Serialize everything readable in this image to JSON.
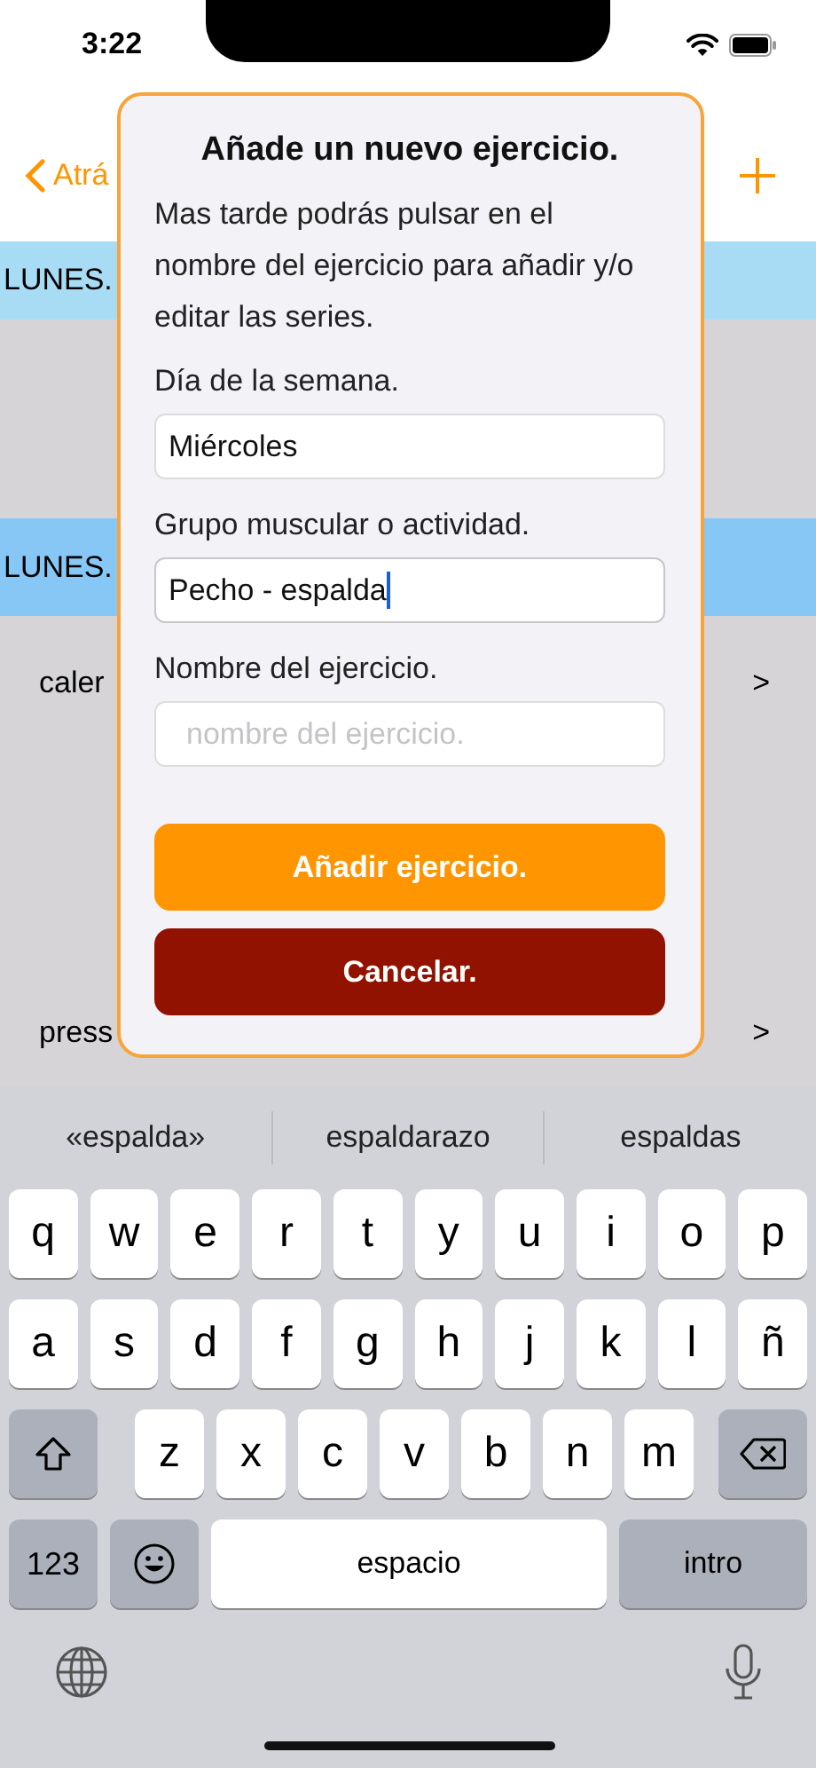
{
  "status_bar": {
    "time": "3:22"
  },
  "nav_bar": {
    "back_label": "Atrá"
  },
  "sections": [
    {
      "header": "LUNES."
    },
    {
      "header": "LUNES.",
      "rows": [
        {
          "label": "caler",
          "chevron": ">"
        },
        {
          "label": "press",
          "chevron": ">"
        }
      ]
    }
  ],
  "dialog": {
    "title": "Añade un nuevo ejercicio.",
    "message": "Mas tarde podrás pulsar en el nombre del ejercicio para añadir y/o editar las series.",
    "fields": [
      {
        "label": "Día de la semana.",
        "value": "Miércoles",
        "focused": false
      },
      {
        "label": "Grupo muscular o actividad.",
        "value": "Pecho - espalda",
        "focused": true
      },
      {
        "label": "Nombre del ejercicio.",
        "placeholder": "nombre del ejercicio.",
        "focused": false
      }
    ],
    "buttons": [
      {
        "label": "Añadir ejercicio.",
        "kind": "primary"
      },
      {
        "label": "Cancelar.",
        "kind": "cancel"
      }
    ]
  },
  "keyboard": {
    "suggestions": [
      "«espalda»",
      "espaldarazo",
      "espaldas"
    ],
    "rows": [
      [
        {
          "kind": "letter",
          "label": "q"
        },
        {
          "kind": "letter",
          "label": "w"
        },
        {
          "kind": "letter",
          "label": "e"
        },
        {
          "kind": "letter",
          "label": "r"
        },
        {
          "kind": "letter",
          "label": "t"
        },
        {
          "kind": "letter",
          "label": "y"
        },
        {
          "kind": "letter",
          "label": "u"
        },
        {
          "kind": "letter",
          "label": "i"
        },
        {
          "kind": "letter",
          "label": "o"
        },
        {
          "kind": "letter",
          "label": "p"
        }
      ],
      [
        {
          "kind": "letter",
          "label": "a"
        },
        {
          "kind": "letter",
          "label": "s"
        },
        {
          "kind": "letter",
          "label": "d"
        },
        {
          "kind": "letter",
          "label": "f"
        },
        {
          "kind": "letter",
          "label": "g"
        },
        {
          "kind": "letter",
          "label": "h"
        },
        {
          "kind": "letter",
          "label": "j"
        },
        {
          "kind": "letter",
          "label": "k"
        },
        {
          "kind": "letter",
          "label": "l"
        },
        {
          "kind": "letter",
          "label": "ñ"
        }
      ],
      [
        {
          "kind": "shift"
        },
        {
          "kind": "letter",
          "label": "z"
        },
        {
          "kind": "letter",
          "label": "x"
        },
        {
          "kind": "letter",
          "label": "c"
        },
        {
          "kind": "letter",
          "label": "v"
        },
        {
          "kind": "letter",
          "label": "b"
        },
        {
          "kind": "letter",
          "label": "n"
        },
        {
          "kind": "letter",
          "label": "m"
        },
        {
          "kind": "delete"
        }
      ]
    ],
    "function_keys": [
      {
        "kind": "numbers",
        "label": "123"
      },
      {
        "kind": "emoji"
      },
      {
        "kind": "space",
        "label": "espacio"
      },
      {
        "kind": "return",
        "label": "intro"
      }
    ]
  }
}
